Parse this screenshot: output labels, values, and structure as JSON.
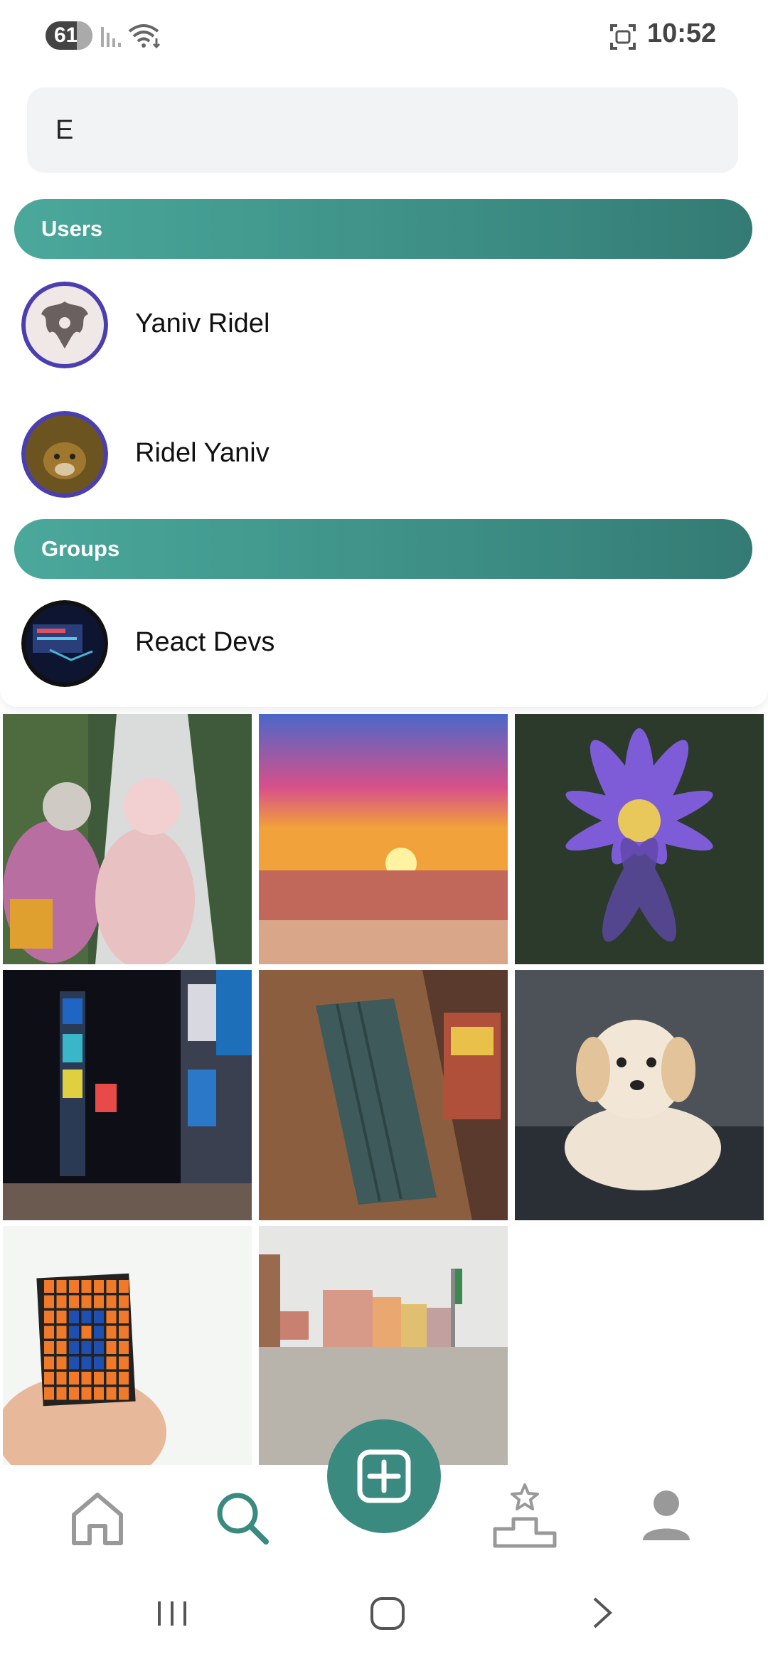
{
  "status_bar": {
    "battery": "61",
    "time": "10:52",
    "icons": [
      "signal-icon",
      "wifi-icon",
      "screenshot-icon"
    ]
  },
  "search": {
    "value": "E",
    "placeholder": ""
  },
  "results": {
    "users_header": "Users",
    "users": [
      {
        "name": "Yaniv Ridel",
        "avatar": "inkblot-avatar"
      },
      {
        "name": "Ridel Yaniv",
        "avatar": "dog-avatar"
      }
    ],
    "groups_header": "Groups",
    "groups": [
      {
        "name": "React Devs",
        "avatar": "screen-avatar"
      }
    ]
  },
  "grid": {
    "photos": [
      "two-women-photo",
      "sunset-beach-photo",
      "purple-lotus-photo",
      "times-square-photo",
      "tablet-case-photo",
      "puppy-photo",
      "rubiks-cube-photo",
      "piazza-photo"
    ]
  },
  "bottom_nav": {
    "items": [
      "home-icon",
      "search-icon",
      "add-post-icon",
      "leaderboard-icon",
      "profile-icon"
    ],
    "active": "search-icon"
  },
  "colors": {
    "accent": "#3a8a80",
    "header_gradient_start": "#4aa89b",
    "header_gradient_end": "#337b74"
  }
}
